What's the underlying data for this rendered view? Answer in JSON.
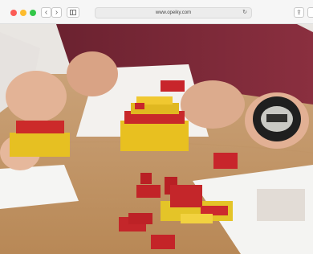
{
  "browser": {
    "url": "www.opeiky.com",
    "back_icon": "‹",
    "forward_icon": "›",
    "reload_icon": "↻",
    "share_icon": "⇪",
    "traffic_colors": [
      "#fc5c56",
      "#fdbc2e",
      "#33c748"
    ]
  },
  "photo": {
    "description_icon": "photo-image"
  }
}
